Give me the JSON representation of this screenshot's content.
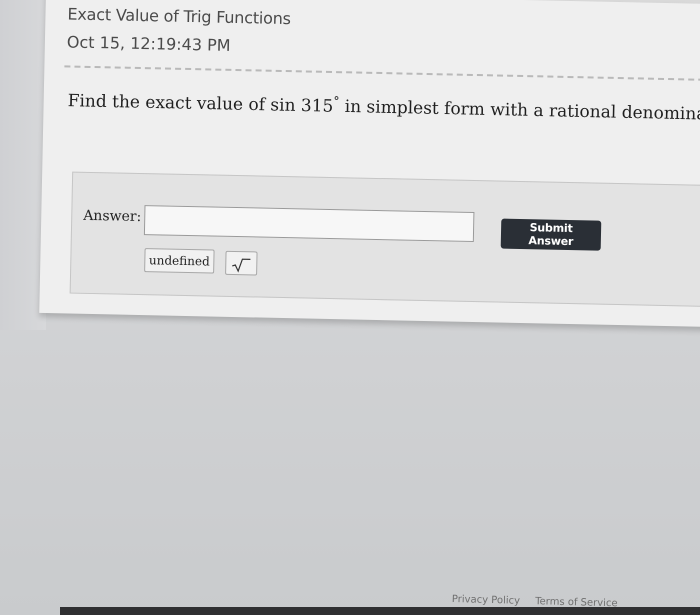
{
  "header": {
    "title": "Exact Value of Trig Functions",
    "timestamp": "Oct 15, 12:19:43 PM"
  },
  "question": {
    "prefix": "Find the exact value of sin 315",
    "degree_symbol": "°",
    "suffix": " in simplest form with a rational denomina"
  },
  "answer": {
    "label": "Answer:",
    "value": "",
    "submit_label": "Submit Answer",
    "undefined_label": "undefined",
    "sqrt_icon": "square-root-icon"
  },
  "footer": {
    "privacy_label": "Privacy Policy",
    "terms_label": "Terms of Service"
  }
}
